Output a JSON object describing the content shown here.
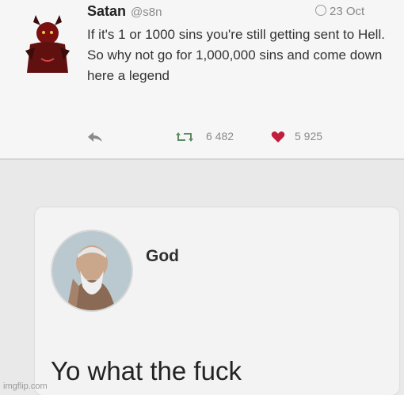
{
  "tweet": {
    "author_name": "Satan",
    "handle": "@s8n",
    "date": "23 Oct",
    "text": "If it's 1 or 1000 sins you're still getting sent to Hell. So why not go for 1,000,000 sins and come down here a legend",
    "retweets": "6 482",
    "likes": "5 925"
  },
  "reply": {
    "author_name": "God",
    "text": "Yo what the fuck"
  },
  "watermark": "imgflip.com",
  "colors": {
    "heart": "#c21d3b",
    "retweet": "#5e8b63",
    "devil": "#7a1010"
  },
  "icons": [
    "devil-avatar",
    "clock-icon",
    "reply-icon",
    "retweet-icon",
    "heart-icon",
    "god-avatar"
  ]
}
